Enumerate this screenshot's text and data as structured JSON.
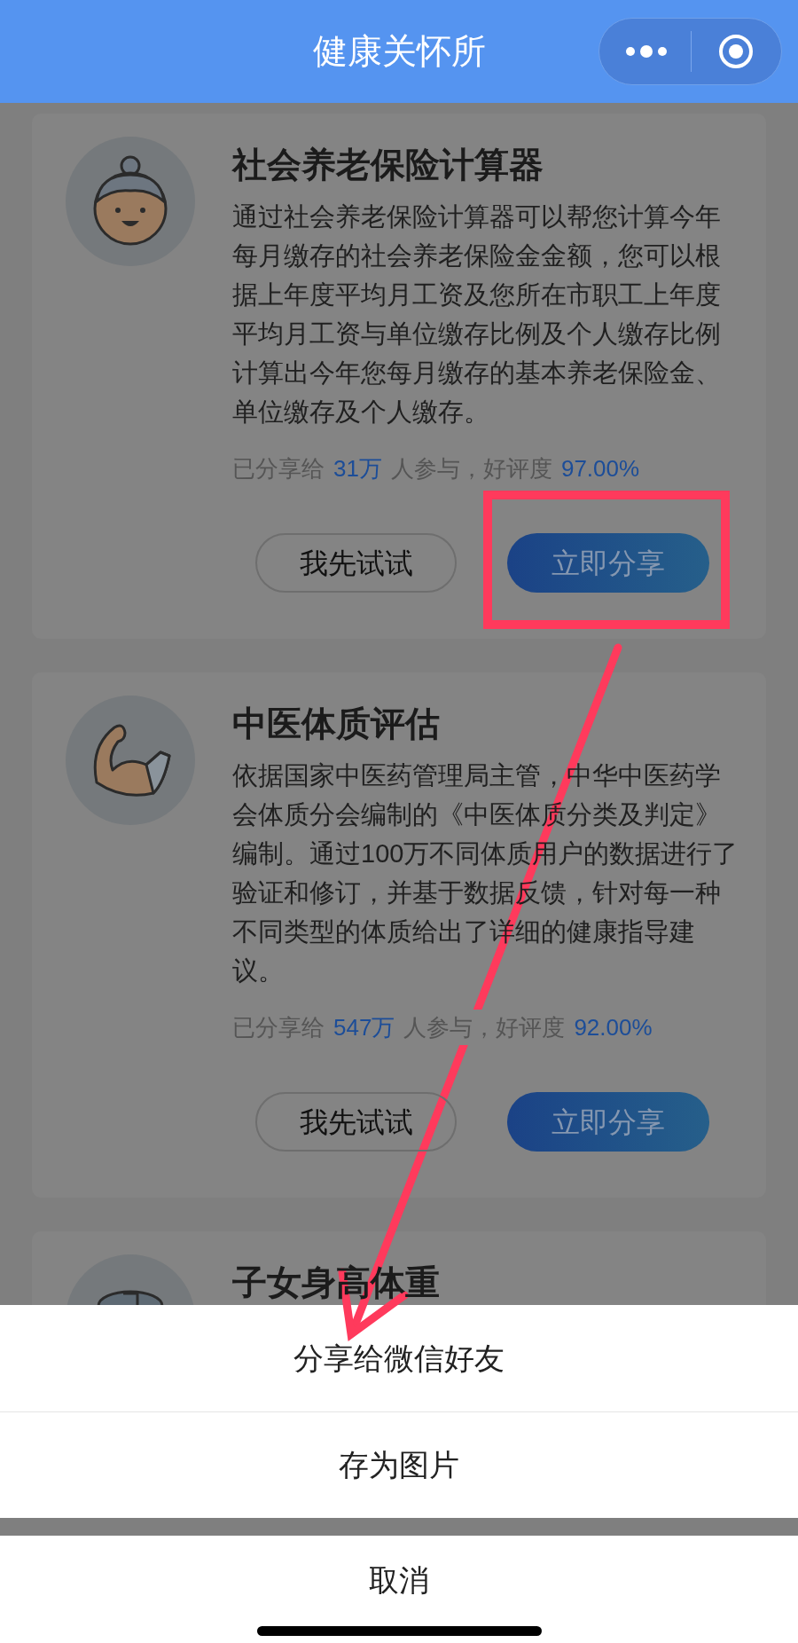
{
  "nav_bar": {
    "title": "健康关怀所"
  },
  "cards": [
    {
      "kind": "grandma",
      "title": "社会养老保险计算器",
      "description": [
        "通过社会养老保险计算器可以帮您计算今年",
        "每月缴存的社会养老保险金金额，您可以根",
        "据上年度平均月工资及您所在市职工上年度",
        "平均月工资与单位缴存比例及个人缴存比例",
        "计算出今年您每月缴存的基本养老保险金、",
        "单位缴存及个人缴存。"
      ],
      "stats": {
        "prefix": "已分享给",
        "shared": "31万",
        "middle": "人参与，好评度",
        "rating": "97.00%"
      },
      "buttons": {
        "try": "我先试试",
        "share": "立即分享"
      },
      "highlighted": true
    },
    {
      "kind": "arm",
      "title": "中医体质评估",
      "description": [
        "依据国家中医药管理局主管，中华中医药学",
        "会体质分会编制的《中医体质分类及判定》",
        "编制。通过100万不同体质用户的数据进行了",
        "验证和修订，并基于数据反馈，针对每一种",
        "不同类型的体质给出了详细的健康指导建",
        "议。"
      ],
      "stats": {
        "prefix": "已分享给",
        "shared": "547万",
        "middle": "人参与，好评度",
        "rating": "92.00%"
      },
      "buttons": {
        "try": "我先试试",
        "share": "立即分享"
      },
      "highlighted": false
    },
    {
      "kind": "scale",
      "title": "子女身高体重"
    }
  ],
  "action_sheet": {
    "options": [
      "分享给微信好友",
      "存为图片"
    ],
    "cancel": "取消"
  }
}
